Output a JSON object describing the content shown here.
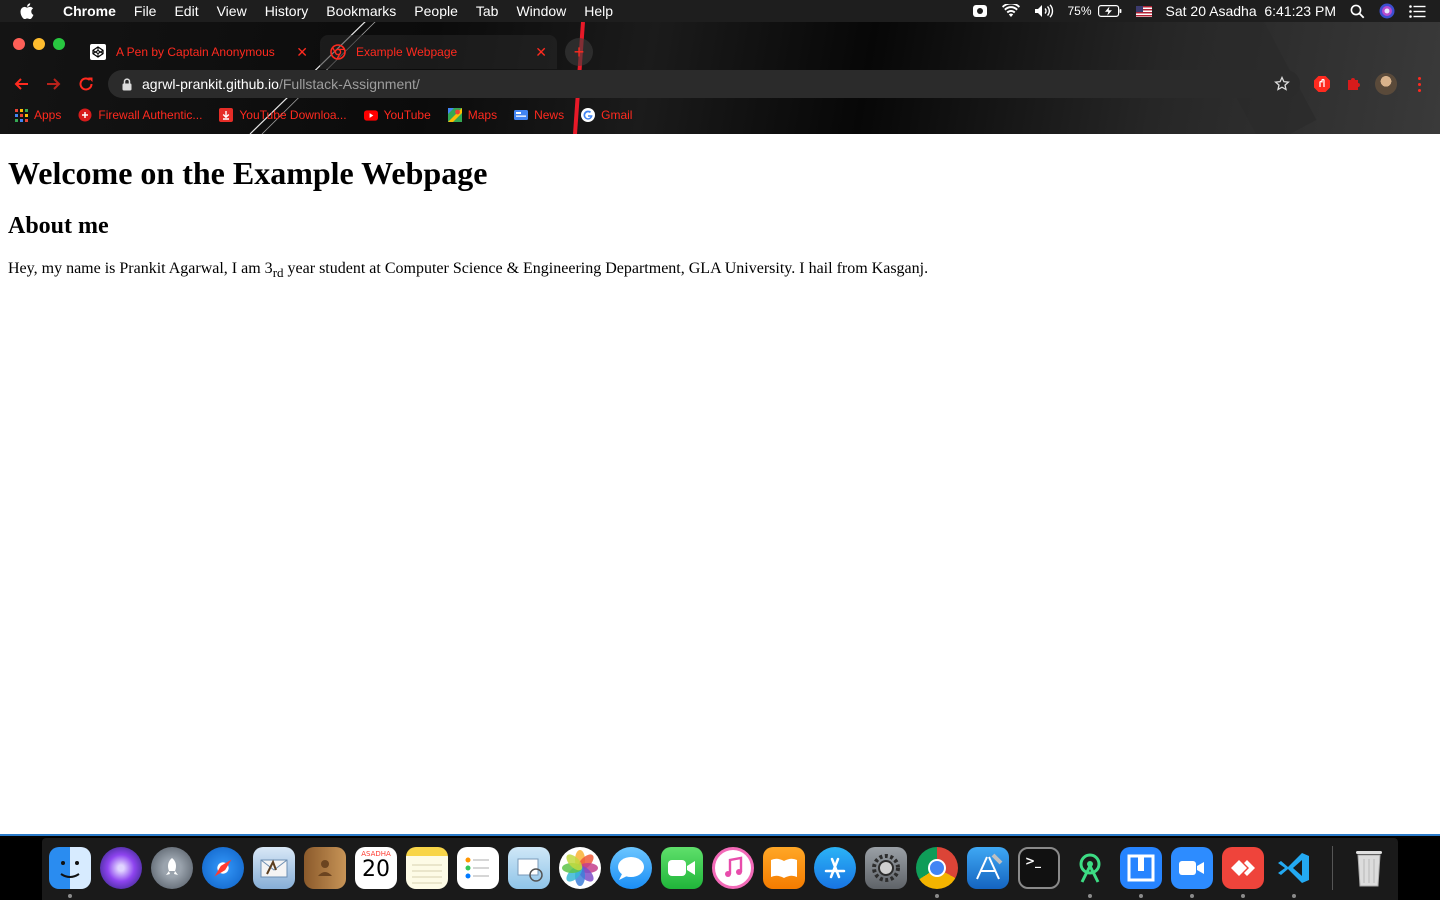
{
  "menubar": {
    "app_name": "Chrome",
    "items": [
      "File",
      "Edit",
      "View",
      "History",
      "Bookmarks",
      "People",
      "Tab",
      "Window",
      "Help"
    ],
    "battery": "75%",
    "datetime": "Sat 20 Asadha  6:41:23 PM"
  },
  "tabs": [
    {
      "title": "A Pen by Captain Anonymous",
      "icon": "codepen-icon"
    },
    {
      "title": "Example Webpage",
      "icon": "chrome-icon"
    }
  ],
  "omnibox": {
    "host": "agrwl-prankit.github.io",
    "path": "/Fullstack-Assignment/"
  },
  "bookmarks": [
    {
      "label": "Apps",
      "icon": "apps-grid-icon"
    },
    {
      "label": "Firewall Authentic...",
      "icon": "firewall-icon"
    },
    {
      "label": "YouTube Downloa...",
      "icon": "download-icon"
    },
    {
      "label": "YouTube",
      "icon": "youtube-icon"
    },
    {
      "label": "Maps",
      "icon": "maps-icon"
    },
    {
      "label": "News",
      "icon": "news-icon"
    },
    {
      "label": "Gmail",
      "icon": "google-icon"
    }
  ],
  "page": {
    "heading": "Welcome on the Example Webpage",
    "subheading": "About me",
    "paragraph_before": "Hey, my name is Prankit Agarwal, I am 3",
    "paragraph_sub": "rd",
    "paragraph_after": " year student at Computer Science & Engineering Department, GLA University. I hail from Kasganj."
  },
  "dock": {
    "calendar_month": "ASADHA",
    "calendar_day": "20",
    "apps": [
      "finder-icon",
      "siri-icon",
      "launchpad-icon",
      "safari-icon",
      "mail-icon",
      "contacts-icon",
      "calendar-icon",
      "notes-icon",
      "reminders-icon",
      "preview-icon",
      "photos-icon",
      "messages-icon",
      "facetime-icon",
      "itunes-icon",
      "books-icon",
      "app-store-icon",
      "system-preferences-icon",
      "chrome-icon",
      "xcode-icon",
      "terminal-icon",
      "android-studio-icon",
      "sourcetree-icon",
      "zoom-icon",
      "anydesk-icon",
      "vscode-icon",
      "trash-icon"
    ]
  },
  "colors": {
    "accent_red": "#ff2a1f",
    "menubar_bg": "#1e1e1e",
    "omnibox_bg": "#2b2b2b"
  }
}
